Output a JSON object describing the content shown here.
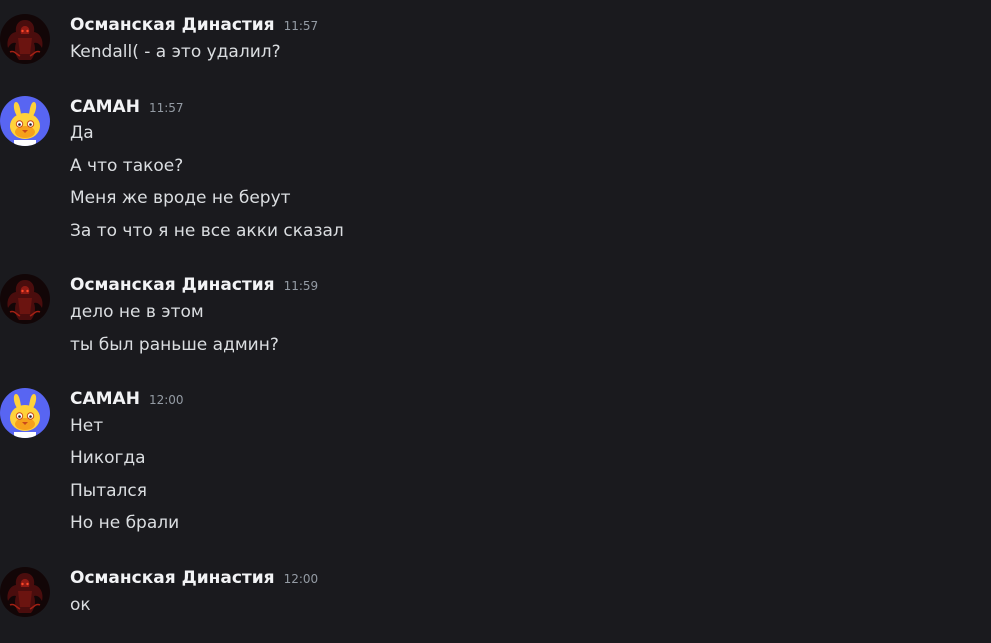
{
  "messages": [
    {
      "author": "Османская Династия",
      "avatar_icon": "dark-red-figure-avatar",
      "time": "11:57",
      "lines": [
        "Kendall( - а это удалил?"
      ]
    },
    {
      "author": "САМАН",
      "avatar_icon": "yellow-bunny-avatar",
      "time": "11:57",
      "lines": [
        "Да",
        "А что такое?",
        "Меня же вроде не берут",
        "За то что я не все акки сказал"
      ]
    },
    {
      "author": "Османская Династия",
      "avatar_icon": "dark-red-figure-avatar",
      "time": "11:59",
      "lines": [
        "дело не в этом",
        "ты был раньше админ?"
      ]
    },
    {
      "author": "САМАН",
      "avatar_icon": "yellow-bunny-avatar",
      "time": "12:00",
      "lines": [
        "Нет",
        "Никогда",
        "Пытался",
        "Но не брали"
      ]
    },
    {
      "author": "Османская Династия",
      "avatar_icon": "dark-red-figure-avatar",
      "time": "12:00",
      "lines": [
        "ок"
      ]
    }
  ],
  "colors": {
    "background": "#1a1a1e",
    "username": "#f2f3f5",
    "text": "#dbdee1",
    "timestamp": "#949ba4",
    "bunny_bg": "#5865f2"
  }
}
